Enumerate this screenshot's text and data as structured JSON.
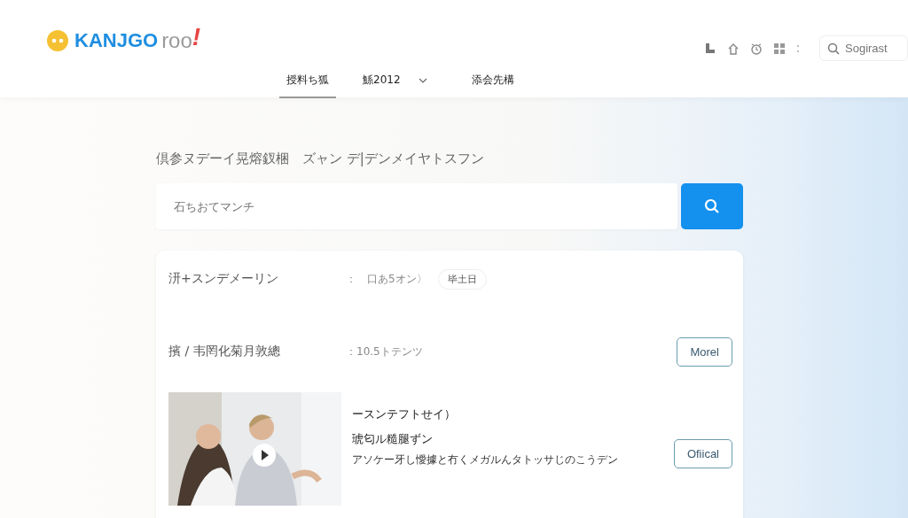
{
  "logo": {
    "word_1": "KANJGO",
    "word_2": "roo",
    "mark": "!"
  },
  "nav": [
    {
      "label": "授料ち狐",
      "selected": true,
      "dropdown": false
    },
    {
      "label": "鯀2012",
      "selected": false,
      "dropdown": true
    },
    {
      "label": "添会先構",
      "selected": false,
      "dropdown": false
    }
  ],
  "header_search": {
    "placeholder": "Sogirast"
  },
  "heading": "倶参ヌデーイ晃熔釵梱　ズャン デ|デンメイヤトスフン",
  "search": {
    "placeholder": "石ちおてマンチ"
  },
  "rows": [
    {
      "label": "汧+スンデメーリン",
      "value": "：　口あ5オン〉",
      "tag": "毕土日"
    },
    {
      "label": "擯 / 韦罔化菊月敦總",
      "value": "：10.5トテンツ",
      "button": "Morel"
    }
  ],
  "video": {
    "kind": "picture",
    "title": "ースンテフトせイ）",
    "subtitle": "琥匂ル糙腿ずン",
    "description": "アソケー牙し懓據と冇くメガルんタトッサじのこうデン",
    "button": "Ofiical"
  }
}
